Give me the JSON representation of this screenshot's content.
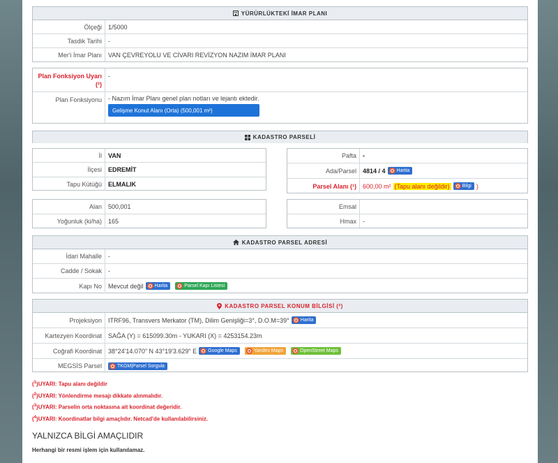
{
  "imar": {
    "title": "YÜRÜRLÜKTEKİ İMAR PLANI",
    "rows": [
      {
        "label": "Ölçeği",
        "value": "1/5000"
      },
      {
        "label": "Tasdik Tarihi",
        "value": "-"
      },
      {
        "label": "Mer'i İmar Planı",
        "value": "VAN ÇEVREYOLU VE CİVARI REVİZYON NAZIM İMAR PLANI"
      }
    ]
  },
  "plan": {
    "uyari_label": "Plan Fonksiyon Uyarı (²)",
    "uyari_value": "-",
    "fonk_label": "Plan Fonksiyonu",
    "fonk_note": "- Nazım İmar Planı genel plan notları ve lejantı ektedir.",
    "fonk_button": "Gelişme Konut Alanı (Orta) (500,001 m²)"
  },
  "kadastro": {
    "title": "KADASTRO PARSELİ",
    "left": [
      {
        "label": "İl",
        "value": "VAN"
      },
      {
        "label": "İlçesi",
        "value": "EDREMİT"
      },
      {
        "label": "Tapu Kütüğü",
        "value": "ELMALIK"
      }
    ],
    "pafta_label": "Pafta",
    "pafta_value": "-",
    "adaparsel_label": "Ada/Parsel",
    "adaparsel_value": "4814 / 4",
    "harita_btn": "Harita",
    "alan_label": "Parsel Alanı (¹)",
    "alan_value": "600,00 m²",
    "alan_warn": "(Tapu alanı değildir)",
    "bilgi_btn": "Bilgi",
    "alan_close": ")",
    "alan2_label": "Alan",
    "alan2_value": "500,001",
    "yog_label": "Yoğunluk (ki/ha)",
    "yog_value": "165",
    "emsal_label": "Emsal",
    "emsal_value": "",
    "hmax_label": "Hmax",
    "hmax_value": "-"
  },
  "adres": {
    "title": "KADASTRO PARSEL ADRESİ",
    "mahalle_label": "İdari Mahalle",
    "mahalle_value": "-",
    "cadde_label": "Cadde / Sokak",
    "cadde_value": "-",
    "kapi_label": "Kapı No",
    "kapi_value": "Mevcut değil",
    "harita_btn": "Harita",
    "kapi_list_btn": "Parsel Kapı Listesi"
  },
  "konum": {
    "title": "KADASTRO PARSEL KONUM BİLGİSİ (²)",
    "proj_label": "Projeksiyon",
    "proj_value": "ITRF96, Transvers Merkator (TM), Dilim Genişliği=3°, D.O.M=39°",
    "harita_btn": "Harita",
    "kart_label": "Kartezyen Koordinat",
    "kart_value": "SAĞA (Y) = 615099.30m - YUKARI (X) = 4253154.23m",
    "cog_label": "Coğrafi Koordinat",
    "cog_value": "38°24'14.070\" N 43°19'3.629\" E",
    "google_btn": "Google Maps",
    "yandex_btn": "Yandex Maps",
    "osm_btn": "OpenStreet Maps",
    "megsis_label": "MEGSİS Parsel",
    "megsis_btn": "TKGM|Parsel Sorgula"
  },
  "notes": [
    {
      "n": "1",
      "text": "UYARI: Tapu alanı değildir"
    },
    {
      "n": "2",
      "text": "UYARI: Yönlendirme mesajı dikkate alınmalıdır."
    },
    {
      "n": "3",
      "text": "UYARI: Parselin orta noktasına ait koordinat değeridir."
    },
    {
      "n": "4",
      "text": "UYARI: Koordinatlar bilgi amaçlıdır. Netcad'de kullanılabilirsiniz."
    }
  ],
  "footer": {
    "title": "YALNIZCA BİLGİ AMAÇLIDIR",
    "subtitle": "Herhangi bir resmi işlem için kullanılamaz."
  }
}
